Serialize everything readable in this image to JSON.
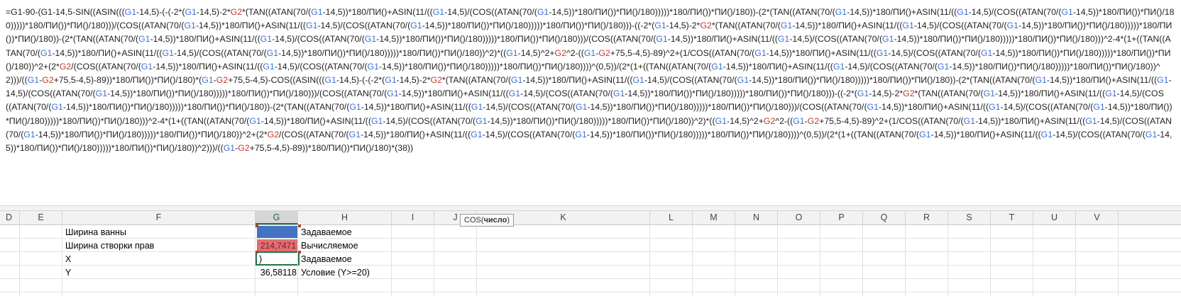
{
  "formula_bar": {
    "parts": [
      [
        "t",
        "=G1-90-(G1-14,5-SIN((ASIN((("
      ],
      [
        "r",
        "G1"
      ],
      [
        "t",
        "-14,5)-(-(-2*("
      ],
      [
        "r",
        "G1"
      ],
      [
        "t",
        "-14,5)-2*"
      ],
      [
        "r2",
        "G2"
      ],
      [
        "t",
        "*(TAN((ATAN(70/("
      ],
      [
        "r",
        "G1"
      ],
      [
        "t",
        "-14,5))*180/ПИ()+ASIN(11/(("
      ],
      [
        "r",
        "G1"
      ],
      [
        "t",
        "-14,5)/(COS((ATAN(70/("
      ],
      [
        "r",
        "G1"
      ],
      [
        "t",
        "-14,5))*180/ПИ())*ПИ()/180)))))*180/ПИ())*ПИ()/180))-(2*(TAN((ATAN(70/("
      ],
      [
        "r",
        "G1"
      ],
      [
        "t",
        "-14,5))*180/ПИ()+ASIN(11/(("
      ],
      [
        "r",
        "G1"
      ],
      [
        "t",
        "-14,5)/(COS((ATAN(70/("
      ],
      [
        "r",
        "G1"
      ],
      [
        "t",
        "-14,5))*180/ПИ())*ПИ()/180)))))*180/ПИ())*ПИ()/180)))/(COS((ATAN(70/("
      ],
      [
        "r",
        "G1"
      ],
      [
        "t",
        "-14,5))*180/ПИ()+ASIN(11/(("
      ],
      [
        "r",
        "G1"
      ],
      [
        "t",
        "-14,5)/(COS((ATAN(70/("
      ],
      [
        "r",
        "G1"
      ],
      [
        "t",
        "-14,5))*180/ПИ())*ПИ()/180)))))*180/ПИ())*ПИ()/180)))-((-2*("
      ],
      [
        "r",
        "G1"
      ],
      [
        "t",
        "-14,5)-2*"
      ],
      [
        "r2",
        "G2"
      ],
      [
        "t",
        "*(TAN((ATAN(70/("
      ],
      [
        "r",
        "G1"
      ],
      [
        "t",
        "-14,5))*180/ПИ()+ASIN(11/(("
      ],
      [
        "r",
        "G1"
      ],
      [
        "t",
        "-14,5)/(COS((ATAN(70/("
      ],
      [
        "r",
        "G1"
      ],
      [
        "t",
        "-14,5))*180/ПИ())*ПИ()/180)))))*180/ПИ())*ПИ()/180))-(2*(TAN((ATAN(70/("
      ],
      [
        "r",
        "G1"
      ],
      [
        "t",
        "-14,5))*180/ПИ()+ASIN(11/(("
      ],
      [
        "r",
        "G1"
      ],
      [
        "t",
        "-14,5)/(COS((ATAN(70/("
      ],
      [
        "r",
        "G1"
      ],
      [
        "t",
        "-14,5))*180/ПИ())*ПИ()/180)))))*180/ПИ())*ПИ()/180)))/(COS((ATAN(70/("
      ],
      [
        "r",
        "G1"
      ],
      [
        "t",
        "-14,5))*180/ПИ()+ASIN(11/(("
      ],
      [
        "r",
        "G1"
      ],
      [
        "t",
        "-14,5)/(COS((ATAN(70/("
      ],
      [
        "r",
        "G1"
      ],
      [
        "t",
        "-14,5))*180/ПИ())*ПИ()/180)))))*180/ПИ())*ПИ()/180)))^2-4*(1+((TAN((ATAN(70/("
      ],
      [
        "r",
        "G1"
      ],
      [
        "t",
        "-14,5))*180/ПИ()+ASIN(11/(("
      ],
      [
        "r",
        "G1"
      ],
      [
        "t",
        "-14,5)/(COS((ATAN(70/("
      ],
      [
        "r",
        "G1"
      ],
      [
        "t",
        "-14,5))*180/ПИ())*ПИ()/180)))))*180/ПИ())*ПИ()/180))^2)*(("
      ],
      [
        "r",
        "G1"
      ],
      [
        "t",
        "-14,5)^2+"
      ],
      [
        "r2",
        "G2"
      ],
      [
        "t",
        "^2-(("
      ],
      [
        "r",
        "G1"
      ],
      [
        "t",
        "-"
      ],
      [
        "r2",
        "G2"
      ],
      [
        "t",
        "+75,5-4,5)-89)^2+(1/COS((ATAN(70/("
      ],
      [
        "r",
        "G1"
      ],
      [
        "t",
        "-14,5))*180/ПИ()+ASIN(11/(("
      ],
      [
        "r",
        "G1"
      ],
      [
        "t",
        "-14,5)/(COS((ATAN(70/("
      ],
      [
        "r",
        "G1"
      ],
      [
        "t",
        "-14,5))*180/ПИ())*ПИ()/180)))))*180/ПИ())*ПИ()/180))^2+(2*"
      ],
      [
        "r2",
        "G2"
      ],
      [
        "t",
        "/(COS((ATAN(70/("
      ],
      [
        "r",
        "G1"
      ],
      [
        "t",
        "-14,5))*180/ПИ()+ASIN(11/(("
      ],
      [
        "r",
        "G1"
      ],
      [
        "t",
        "-14,5)/(COS((ATAN(70/("
      ],
      [
        "r",
        "G1"
      ],
      [
        "t",
        "-14,5))*180/ПИ())*ПИ()/180)))))*180/ПИ())*ПИ()/180))))^(0,5))/(2*(1+((TAN((ATAN(70/("
      ],
      [
        "r",
        "G1"
      ],
      [
        "t",
        "-14,5))*180/ПИ()+ASIN(11/(("
      ],
      [
        "r",
        "G1"
      ],
      [
        "t",
        "-14,5)/(COS((ATAN(70/("
      ],
      [
        "r",
        "G1"
      ],
      [
        "t",
        "-14,5))*180/ПИ())*ПИ()/180)))))*180/ПИ())*ПИ()/180))^2)))/(("
      ],
      [
        "r",
        "G1"
      ],
      [
        "t",
        "-"
      ],
      [
        "r2",
        "G2"
      ],
      [
        "t",
        "+75,5-4,5)-89))*180/ПИ())*ПИ()/180)*("
      ],
      [
        "r",
        "G1"
      ],
      [
        "t",
        "-"
      ],
      [
        "r2",
        "G2"
      ],
      [
        "t",
        "+75,5-4,5)-COS((ASIN((("
      ],
      [
        "r",
        "G1"
      ],
      [
        "t",
        "-14,5)-(-(-2*("
      ],
      [
        "r",
        "G1"
      ],
      [
        "t",
        "-14,5)-2*"
      ],
      [
        "r2",
        "G2"
      ],
      [
        "t",
        "*(TAN((ATAN(70/("
      ],
      [
        "r",
        "G1"
      ],
      [
        "t",
        "-14,5))*180/ПИ()+ASIN(11/(("
      ],
      [
        "r",
        "G1"
      ],
      [
        "t",
        "-14,5)/(COS((ATAN(70/("
      ],
      [
        "r",
        "G1"
      ],
      [
        "t",
        "-14,5))*180/ПИ())*ПИ()/180)))))*180/ПИ())*ПИ()/180))-(2*(TAN((ATAN(70/("
      ],
      [
        "r",
        "G1"
      ],
      [
        "t",
        "-14,5))*180/ПИ()+ASIN(11/(("
      ],
      [
        "r",
        "G1"
      ],
      [
        "t",
        "-14,5)/(COS((ATAN(70/("
      ],
      [
        "r",
        "G1"
      ],
      [
        "t",
        "-14,5))*180/ПИ())*ПИ()/180)))))*180/ПИ())*ПИ()/180)))/(COS((ATAN(70/("
      ],
      [
        "r",
        "G1"
      ],
      [
        "t",
        "-14,5))*180/ПИ()+ASIN(11/(("
      ],
      [
        "r",
        "G1"
      ],
      [
        "t",
        "-14,5)/(COS((ATAN(70/("
      ],
      [
        "r",
        "G1"
      ],
      [
        "t",
        "-14,5))*180/ПИ())*ПИ()/180)))))*180/ПИ())*ПИ()/180)))-((-2*("
      ],
      [
        "r",
        "G1"
      ],
      [
        "t",
        "-14,5)-2*"
      ],
      [
        "r2",
        "G2"
      ],
      [
        "t",
        "*(TAN((ATAN(70/("
      ],
      [
        "r",
        "G1"
      ],
      [
        "t",
        "-14,5))*180/ПИ()+ASIN(11/(("
      ],
      [
        "r",
        "G1"
      ],
      [
        "t",
        "-14,5)/(COS((ATAN(70/("
      ],
      [
        "r",
        "G1"
      ],
      [
        "t",
        "-14,5))*180/ПИ())*ПИ()/180)))))*180/ПИ())*ПИ()/180))-(2*(TAN((ATAN(70/("
      ],
      [
        "r",
        "G1"
      ],
      [
        "t",
        "-14,5))*180/ПИ()+ASIN(11/(("
      ],
      [
        "r",
        "G1"
      ],
      [
        "t",
        "-14,5)/(COS((ATAN(70/("
      ],
      [
        "r",
        "G1"
      ],
      [
        "t",
        "-14,5))*180/ПИ())*ПИ()/180)))))*180/ПИ())*ПИ()/180)))/(COS((ATAN(70/("
      ],
      [
        "r",
        "G1"
      ],
      [
        "t",
        "-14,5))*180/ПИ()+ASIN(11/(("
      ],
      [
        "r",
        "G1"
      ],
      [
        "t",
        "-14,5)/(COS((ATAN(70/("
      ],
      [
        "r",
        "G1"
      ],
      [
        "t",
        "-14,5))*180/ПИ())*ПИ()/180)))))*180/ПИ())*ПИ()/180)))^2-4*(1+((TAN((ATAN(70/("
      ],
      [
        "r",
        "G1"
      ],
      [
        "t",
        "-14,5))*180/ПИ()+ASIN(11/(("
      ],
      [
        "r",
        "G1"
      ],
      [
        "t",
        "-14,5)/(COS((ATAN(70/("
      ],
      [
        "r",
        "G1"
      ],
      [
        "t",
        "-14,5))*180/ПИ())*ПИ()/180)))))*180/ПИ())*ПИ()/180))^2)*(("
      ],
      [
        "r",
        "G1"
      ],
      [
        "t",
        "-14,5)^2+"
      ],
      [
        "r2",
        "G2"
      ],
      [
        "t",
        "^2-(("
      ],
      [
        "r",
        "G1"
      ],
      [
        "t",
        "-"
      ],
      [
        "r2",
        "G2"
      ],
      [
        "t",
        "+75,5-4,5)-89)^2+(1/COS((ATAN(70/("
      ],
      [
        "r",
        "G1"
      ],
      [
        "t",
        "-14,5))*180/ПИ()+ASIN(11/(("
      ],
      [
        "r",
        "G1"
      ],
      [
        "t",
        "-14,5)/(COS((ATAN(70/("
      ],
      [
        "r",
        "G1"
      ],
      [
        "t",
        "-14,5))*180/ПИ())*ПИ()/180)))))*180/ПИ())*ПИ()/180))^2+(2*"
      ],
      [
        "r2",
        "G2"
      ],
      [
        "t",
        "/(COS((ATAN(70/("
      ],
      [
        "r",
        "G1"
      ],
      [
        "t",
        "-14,5))*180/ПИ()+ASIN(11/(("
      ],
      [
        "r",
        "G1"
      ],
      [
        "t",
        "-14,5)/(COS((ATAN(70/("
      ],
      [
        "r",
        "G1"
      ],
      [
        "t",
        "-14,5))*180/ПИ())*ПИ()/180)))))*180/ПИ())*ПИ()/180))))^(0,5))/(2*(1+((TAN((ATAN(70/("
      ],
      [
        "r",
        "G1"
      ],
      [
        "t",
        "-14,5))*180/ПИ()+ASIN(11/(("
      ],
      [
        "r",
        "G1"
      ],
      [
        "t",
        "-14,5)/(COS((ATAN(70/("
      ],
      [
        "r",
        "G1"
      ],
      [
        "t",
        "-14,5))*180/ПИ())*ПИ()/180)))))*180/ПИ())*ПИ()/180))^2)))/(("
      ],
      [
        "r",
        "G1"
      ],
      [
        "t",
        "-"
      ],
      [
        "r2",
        "G2"
      ],
      [
        "t",
        "+75,5-4,5)-89))*180/ПИ())*ПИ()/180)*(38))"
      ]
    ]
  },
  "tooltip": {
    "fn": "COS(",
    "arg": "число",
    "close": ")"
  },
  "columns": [
    "D",
    "E",
    "F",
    "G",
    "H",
    "I",
    "J",
    "K",
    "L",
    "M",
    "N",
    "O",
    "P",
    "Q",
    "R",
    "S",
    "T",
    "U",
    "V"
  ],
  "selected_column": "G",
  "rows": [
    {
      "f": "Ширина ванны",
      "g": "",
      "h": "Задаваемое"
    },
    {
      "f": "Ширина створки прав",
      "g": "214,7471",
      "h": "Вычисляемое"
    },
    {
      "f": "X",
      "g": ")",
      "h": "Задаваемое"
    },
    {
      "f": "Y",
      "g": "36,58118",
      "h": "Условие (Y>=20)"
    }
  ],
  "colors": {
    "g1_fill": "#4472c4",
    "g2_fill": "#e06e72",
    "selection": "#217346",
    "ref_g1": "#3d6fd1",
    "ref_g2": "#c0392b"
  }
}
